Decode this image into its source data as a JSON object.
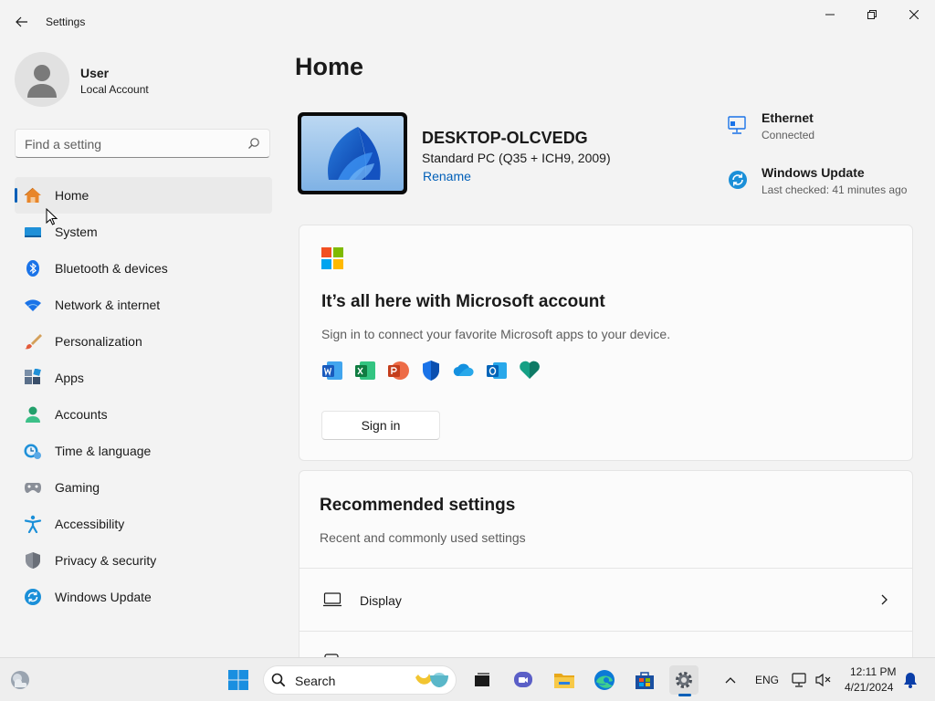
{
  "window": {
    "title": "Settings"
  },
  "profile": {
    "name": "User",
    "account_type": "Local Account"
  },
  "search": {
    "placeholder": "Find a setting"
  },
  "nav": {
    "items": [
      {
        "label": "Home",
        "icon": "home-icon",
        "active": true
      },
      {
        "label": "System",
        "icon": "system-icon"
      },
      {
        "label": "Bluetooth & devices",
        "icon": "bluetooth-icon"
      },
      {
        "label": "Network & internet",
        "icon": "wifi-icon"
      },
      {
        "label": "Personalization",
        "icon": "brush-icon"
      },
      {
        "label": "Apps",
        "icon": "apps-icon"
      },
      {
        "label": "Accounts",
        "icon": "accounts-icon"
      },
      {
        "label": "Time & language",
        "icon": "clock-globe-icon"
      },
      {
        "label": "Gaming",
        "icon": "gamepad-icon"
      },
      {
        "label": "Accessibility",
        "icon": "accessibility-icon"
      },
      {
        "label": "Privacy & security",
        "icon": "shield-icon"
      },
      {
        "label": "Windows Update",
        "icon": "update-icon"
      }
    ]
  },
  "main": {
    "title": "Home",
    "device": {
      "name": "DESKTOP-OLCVEDG",
      "model": "Standard PC (Q35 + ICH9, 2009)",
      "rename_label": "Rename"
    },
    "status": {
      "network": {
        "title": "Ethernet",
        "subtitle": "Connected",
        "icon": "ethernet-icon"
      },
      "update": {
        "title": "Windows Update",
        "subtitle": "Last checked: 41 minutes ago",
        "icon": "update-icon"
      }
    },
    "ms_account_card": {
      "title": "It’s all here with Microsoft account",
      "description": "Sign in to connect your favorite Microsoft apps to your device.",
      "apps": [
        "word-icon",
        "excel-icon",
        "powerpoint-icon",
        "defender-icon",
        "onedrive-icon",
        "outlook-icon",
        "family-safety-icon"
      ],
      "signin_label": "Sign in"
    },
    "recommended": {
      "title": "Recommended settings",
      "subtitle": "Recent and commonly used settings",
      "rows": [
        {
          "label": "Display",
          "icon": "display-icon"
        }
      ]
    }
  },
  "taskbar": {
    "search_label": "Search",
    "tray": {
      "language": "ENG",
      "time": "12:11 PM",
      "date": "4/21/2024"
    }
  },
  "colors": {
    "accent": "#005fb8",
    "background": "#f3f3f3",
    "card": "#fbfbfb"
  }
}
